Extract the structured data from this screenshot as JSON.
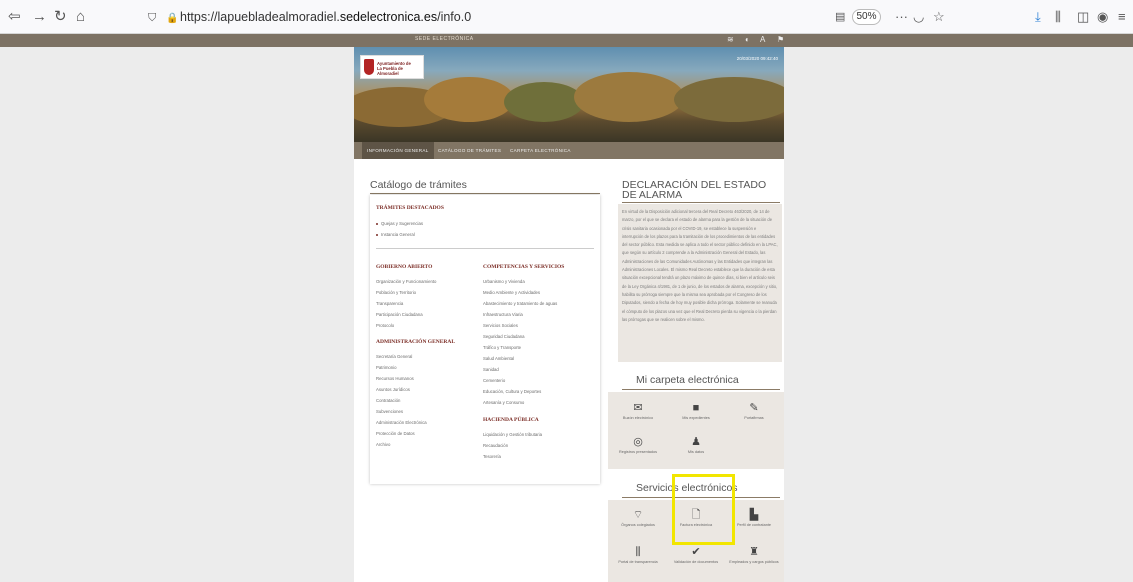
{
  "browser": {
    "back_icon": "arrow-left",
    "forward_icon": "arrow-right",
    "reload_icon": "reload",
    "home_icon": "home",
    "url_prefix": "https://lapuebladealmoradiel.",
    "url_host": "sedelectronica.es",
    "url_suffix": "/info.0",
    "zoom": "50%",
    "more": "···"
  },
  "sede": {
    "label": "SEDE ELECTRÓNICA",
    "timestamp": "20/03/2020 09:42:40",
    "logo_line1": "Ayuntamiento de",
    "logo_line2": "La Puebla de Almoradiel"
  },
  "menu": {
    "items": [
      "INFORMACIÓN GENERAL",
      "CATÁLOGO DE TRÁMITES",
      "CARPETA ELECTRÓNICA"
    ]
  },
  "catalog": {
    "title": "Catálogo de trámites",
    "destacados_title": "TRÁMITES DESTACADOS",
    "destacados": [
      "Quejas y Sugerencias",
      "Instancia General"
    ],
    "gobierno_title": "GOBIERNO ABIERTO",
    "gobierno": [
      "Organización y Funcionamiento",
      "Población y Territorio",
      "Transparencia",
      "Participación Ciudadana",
      "Protocolo"
    ],
    "admin_title": "ADMINISTRACIÓN GENERAL",
    "admin": [
      "Secretaría General",
      "Patrimonio",
      "Recursos Humanos",
      "Asuntos Jurídicos",
      "Contratación",
      "Subvenciones",
      "Administración Electrónica",
      "Protección de Datos",
      "Archivo"
    ],
    "competencias_title": "COMPETENCIAS Y SERVICIOS",
    "competencias": [
      "Urbanismo y Vivienda",
      "Medio Ambiente y Actividades",
      "Abastecimiento y tratamiento de aguas",
      "Infraestructura Viaria",
      "Servicios Sociales",
      "Seguridad Ciudadana",
      "Tráfico y Transporte",
      "Salud Ambiental",
      "Sanidad",
      "Cementerio",
      "Educación, Cultura y Deportes",
      "Artesanía y Consumo"
    ],
    "hacienda_title": "HACIENDA PÚBLICA",
    "hacienda": [
      "Liquidación y Gestión tributaria",
      "Recaudación",
      "Tesorería"
    ]
  },
  "alarm": {
    "title": "DECLARACIÓN DEL ESTADO DE ALARMA",
    "text": "En virtud de la Disposición adicional tercera del Real Decreto 463/2020, de 14 de marzo, por el que se declara el estado de alarma para la gestión de la situación de crisis sanitaria ocasionada por el COVID-19, se establece la suspensión e interrupción de los plazos para la tramitación de los procedimientos de las entidades del sector público. Esta medida se aplica a todo el sector público definido en la LPAC, que según su artículo 2 comprende a la Administración General del Estado, las Administraciones de las Comunidades Autónomas y las Entidades que integran las Administraciones Locales. El mismo Real Decreto establece que la duración de esta situación excepcional tendrá un plazo máximo de quince días, si bien el artículo seis de la Ley Orgánica 4/1981, de 1 de junio, de los estados de alarma, excepción y sitio, habilita su prórroga siempre que la misma sea aprobada por el Congreso de los Diputados, siendo a fecha de hoy muy posible dicha prórroga. Solamente se reanuda el cómputo de los plazos una vez que el Real Decreto pierda su vigencia o la pierdan las prórrogas que se realicen sobre el mismo."
  },
  "carpeta": {
    "title": "Mi carpeta electrónica",
    "items": [
      {
        "label": "Buzón electrónico",
        "icon": "envelope"
      },
      {
        "label": "Mis expedientes",
        "icon": "folder"
      },
      {
        "label": "Portafirmas",
        "icon": "pen"
      },
      {
        "label": "Registros presentados",
        "icon": "registry"
      },
      {
        "label": "Mis datos",
        "icon": "user"
      }
    ]
  },
  "servicios": {
    "title": "Servicios electrónicos",
    "items": [
      {
        "label": "Órganos colegiados",
        "icon": "wifi"
      },
      {
        "label": "Factura electrónica",
        "icon": "document"
      },
      {
        "label": "Perfil de contratante",
        "icon": "stamp"
      },
      {
        "label": "Portal de transparencia",
        "icon": "columns"
      },
      {
        "label": "Validación de documentos",
        "icon": "check"
      },
      {
        "label": "Empleados y cargos públicos",
        "icon": "person-group"
      }
    ]
  }
}
